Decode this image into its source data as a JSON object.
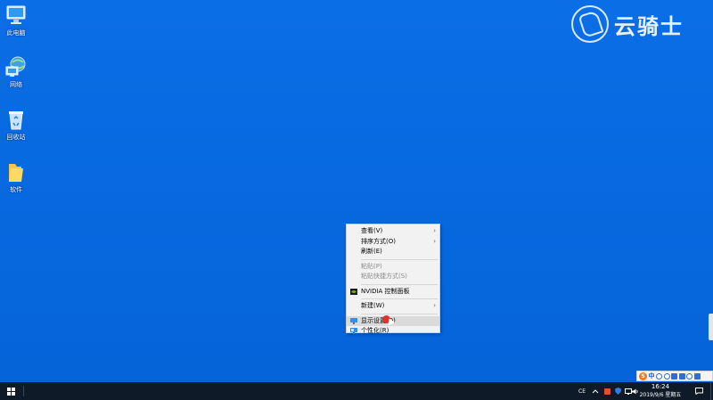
{
  "desktop": {
    "icons": [
      {
        "label": "此电脑"
      },
      {
        "label": "网络"
      },
      {
        "label": "回收站"
      },
      {
        "label": "软件"
      }
    ]
  },
  "watermark": {
    "text": "云骑士"
  },
  "context_menu": {
    "items": [
      {
        "label": "查看(V)",
        "has_submenu": true,
        "disabled": false
      },
      {
        "label": "排序方式(O)",
        "has_submenu": true,
        "disabled": false
      },
      {
        "label": "刷新(E)",
        "has_submenu": false,
        "disabled": false
      },
      {
        "label": "粘贴(P)",
        "has_submenu": false,
        "disabled": true
      },
      {
        "label": "粘贴快捷方式(S)",
        "has_submenu": false,
        "disabled": true
      },
      {
        "label": "NVIDIA 控制面板",
        "has_submenu": false,
        "disabled": false
      },
      {
        "label": "新建(W)",
        "has_submenu": true,
        "disabled": false
      },
      {
        "label": "显示设置(D)",
        "has_submenu": false,
        "disabled": false,
        "highlighted": true
      },
      {
        "label": "个性化(R)",
        "has_submenu": false,
        "disabled": false
      }
    ],
    "submenu_arrow": "›"
  },
  "taskbar": {
    "tray_cn": "CE",
    "clock_time": "16:24",
    "clock_date": "2019/9/6 星期五"
  },
  "ime": {
    "logo": "S",
    "mode": "中"
  },
  "colors": {
    "desktop_bg": "#0a6ee6",
    "taskbar_bg": "#0f1a29",
    "menu_bg": "#f2f2f2",
    "menu_hover": "#dadada",
    "cursor_red": "#e0322a"
  }
}
